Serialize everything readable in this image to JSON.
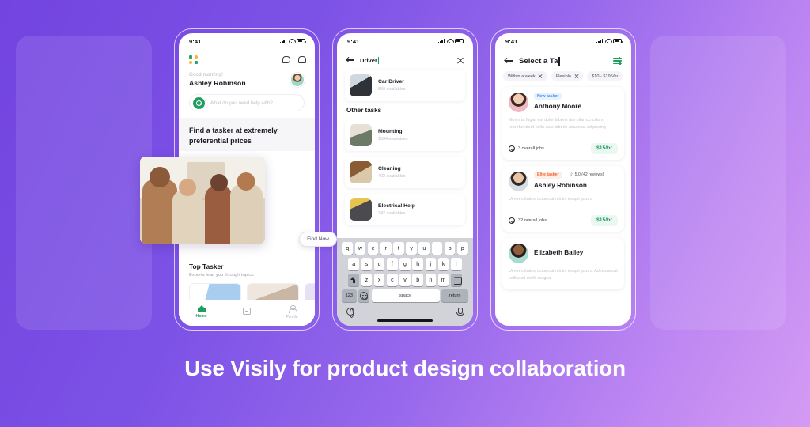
{
  "headline": "Use Visily for product design collaboration",
  "theme": {
    "purple": "#7a4fe4",
    "pink": "#cb8cf0",
    "green": "#1f9e60",
    "blue": "#3d8ef0",
    "orange": "#ef6b33"
  },
  "phone1": {
    "status": {
      "time": "9:41"
    },
    "logo_icon": "four-dot-logo-icon",
    "chat_icon": "chat-icon",
    "bell_icon": "bell-icon",
    "greeting": "Good morning!",
    "user_name": "Ashley Robinson",
    "search_placeholder": "What do you need help with?",
    "promo_headline": "Find a tasker at extremely preferential prices",
    "top_tasker_title": "Top Tasker",
    "top_tasker_sub": "Experts lead you through topics.",
    "find_now_label": "Find Now",
    "tabs": [
      {
        "label": "Home",
        "icon": "home-icon"
      },
      {
        "label": "",
        "icon": "board-icon"
      },
      {
        "label": "Profile",
        "icon": "person-icon"
      }
    ]
  },
  "phone2": {
    "status": {
      "time": "9:41"
    },
    "back_icon": "back-arrow-icon",
    "search_query": "Driver",
    "close_icon": "close-icon",
    "result": {
      "name": "Car Driver",
      "meta": "650 availables"
    },
    "section_title": "Other tasks",
    "tasks": [
      {
        "name": "Mounting",
        "meta": "1534 availables"
      },
      {
        "name": "Cleaning",
        "meta": "402 availables"
      },
      {
        "name": "Electrical Help",
        "meta": "342 availables"
      }
    ],
    "keyboard": {
      "row1": [
        "q",
        "w",
        "e",
        "r",
        "t",
        "y",
        "u",
        "i",
        "o",
        "p"
      ],
      "row2": [
        "a",
        "s",
        "d",
        "f",
        "g",
        "h",
        "j",
        "k",
        "l"
      ],
      "row3": [
        "z",
        "x",
        "c",
        "v",
        "b",
        "n",
        "m"
      ],
      "shift_icon": "shift-icon",
      "delete_icon": "backspace-icon",
      "numeric_label": "123",
      "emoji_icon": "emoji-icon",
      "space_label": "space",
      "return_label": "return",
      "globe_icon": "globe-icon",
      "mic_icon": "microphone-icon"
    }
  },
  "phone3": {
    "status": {
      "time": "9:41"
    },
    "back_icon": "back-arrow-icon",
    "title": "Select a Ta",
    "filter_icon": "filter-sliders-icon",
    "chips": [
      {
        "label": "Within a week",
        "removable": true
      },
      {
        "label": "Flexible",
        "removable": true
      },
      {
        "label": "$10 - $195/hr",
        "removable": false
      }
    ],
    "taskers": [
      {
        "name": "Anthony Moore",
        "badge": "New tasker",
        "badge_type": "new",
        "rating": "",
        "desc": "Minim at fugiat est dolor laboris nisi ullamco cillum reprehenderit nulla aute laboris accaecat adipiscing",
        "jobs": "3 overall jobs",
        "price": "$15/hr"
      },
      {
        "name": "Ashley Robinson",
        "badge": "Elite tasker",
        "badge_type": "elite",
        "rating": "5.0 (42 reviews)",
        "desc": "Ut exercitation occaecat minim eu qui ipsum",
        "jobs": "32 overall jobs",
        "price": "$15/hr"
      },
      {
        "name": "Elizabeth Bailey",
        "badge": "",
        "badge_type": "",
        "rating": "",
        "desc": "Ut exercitation occaecat minim eu qui ipsum. Ad occaecat velit sunt mollit magna",
        "jobs": "",
        "price": ""
      }
    ]
  }
}
